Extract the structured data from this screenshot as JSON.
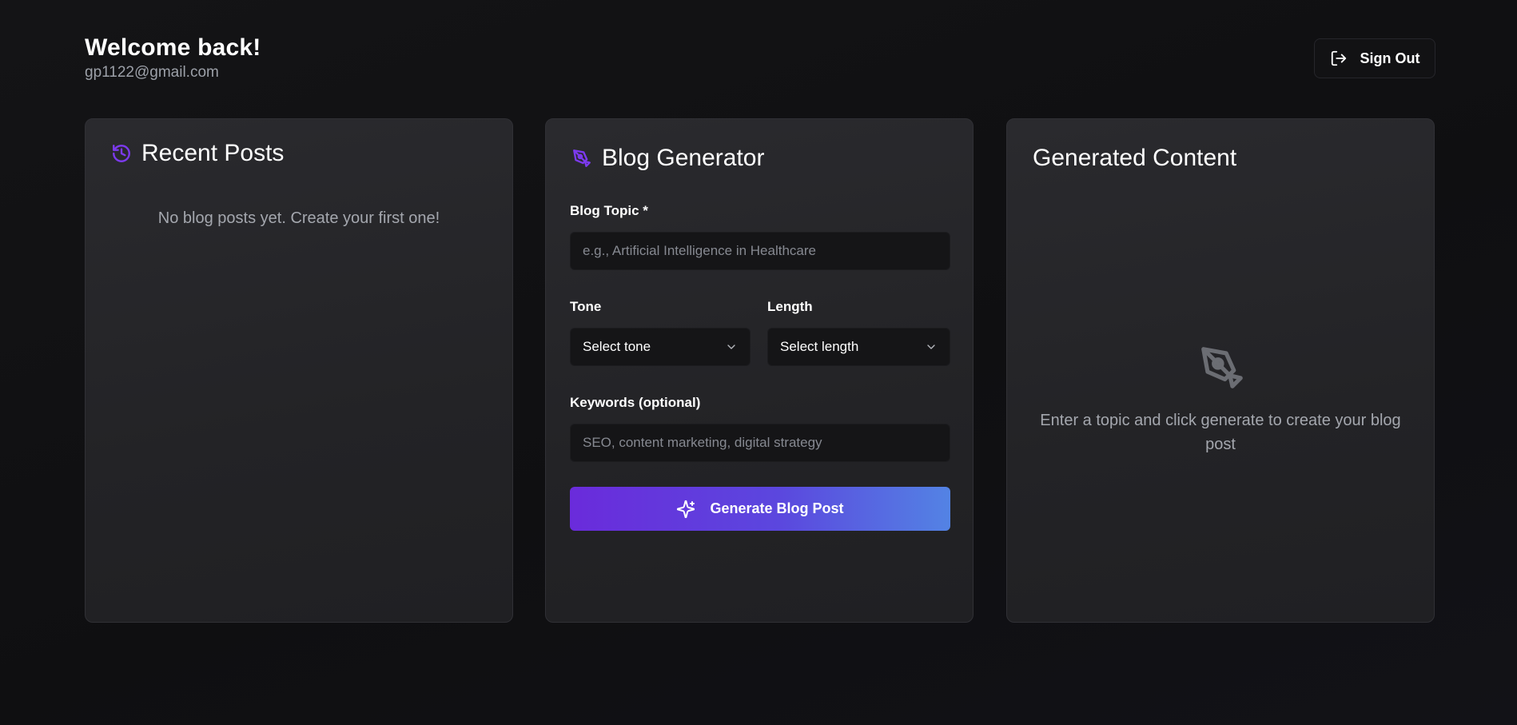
{
  "header": {
    "welcome": "Welcome back!",
    "email": "gp1122@gmail.com",
    "sign_out_label": "Sign Out",
    "sign_out_icon": "log-out-icon"
  },
  "recent_posts": {
    "title": "Recent Posts",
    "icon": "history-icon",
    "empty_text": "No blog posts yet. Create your first one!"
  },
  "generator": {
    "title": "Blog Generator",
    "icon": "pen-tool-icon",
    "topic_label": "Blog Topic *",
    "topic_value": "",
    "topic_placeholder": "e.g., Artificial Intelligence in Healthcare",
    "tone_label": "Tone",
    "tone_value": "Select tone",
    "length_label": "Length",
    "length_value": "Select length",
    "keywords_label": "Keywords (optional)",
    "keywords_value": "",
    "keywords_placeholder": "SEO, content marketing, digital strategy",
    "generate_label": "Generate Blog Post",
    "generate_icon": "sparkles-icon"
  },
  "generated": {
    "title": "Generated Content",
    "icon": "pen-tool-icon",
    "empty_text": "Enter a topic and click generate to create your blog post"
  },
  "colors": {
    "accent_purple": "#7c3aed",
    "button_gradient_start": "#6a2bdb",
    "button_gradient_end": "#5383e4",
    "card_bg": "#26262a",
    "page_bg": "#121214"
  }
}
